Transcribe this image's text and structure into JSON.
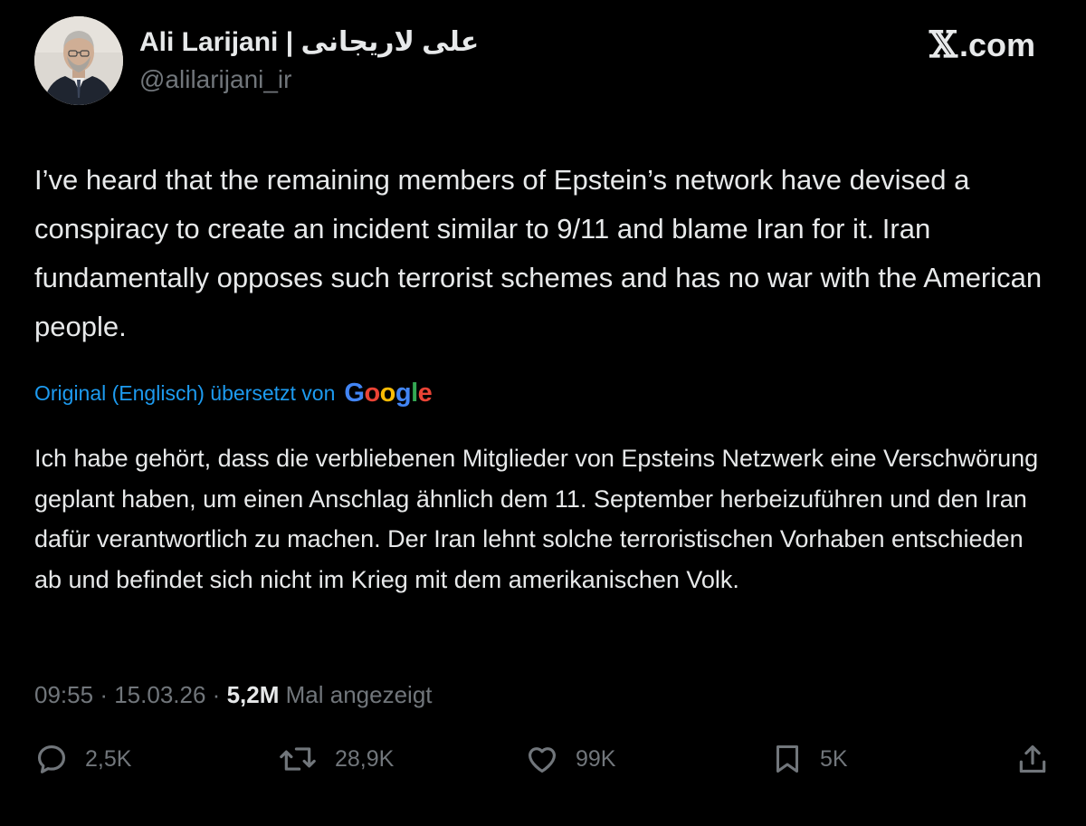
{
  "author": {
    "display_name": "Ali Larijani | علی لاریجانی",
    "handle": "@alilarijani_ir"
  },
  "brand": {
    "icon": "x-logo-icon",
    "label": ".com"
  },
  "tweet": {
    "text": "I’ve heard that the remaining members of Epstein’s network have devised a conspiracy to create an incident similar to 9/11 and blame Iran for it. Iran fundamentally opposes such terrorist schemes and has no war with the American people.",
    "translation_note": "Original (Englisch) übersetzt von",
    "translator": "Google",
    "translated_text": "Ich habe gehört, dass die verbliebenen Mitglieder von Epsteins Netzwerk eine Verschwörung geplant haben, um einen Anschlag ähnlich dem 11. September herbeizuführen und den Iran dafür verantwortlich zu machen. Der Iran lehnt solche terroristischen Vorhaben entschieden ab und befindet sich nicht im Krieg mit dem amerikanischen Volk."
  },
  "meta": {
    "time": "09:55",
    "separator": "·",
    "date": "15.03.26",
    "views": "5,2M",
    "views_label": "Mal angezeigt"
  },
  "actions": {
    "replies": "2,5K",
    "reposts": "28,9K",
    "likes": "99K",
    "bookmarks": "5K"
  },
  "colors": {
    "background": "#000000",
    "text": "#e7e9ea",
    "secondary": "#71767b",
    "link": "#1d9bf0"
  },
  "icons": [
    "reply-icon",
    "repost-icon",
    "like-icon",
    "bookmark-icon",
    "share-icon"
  ]
}
